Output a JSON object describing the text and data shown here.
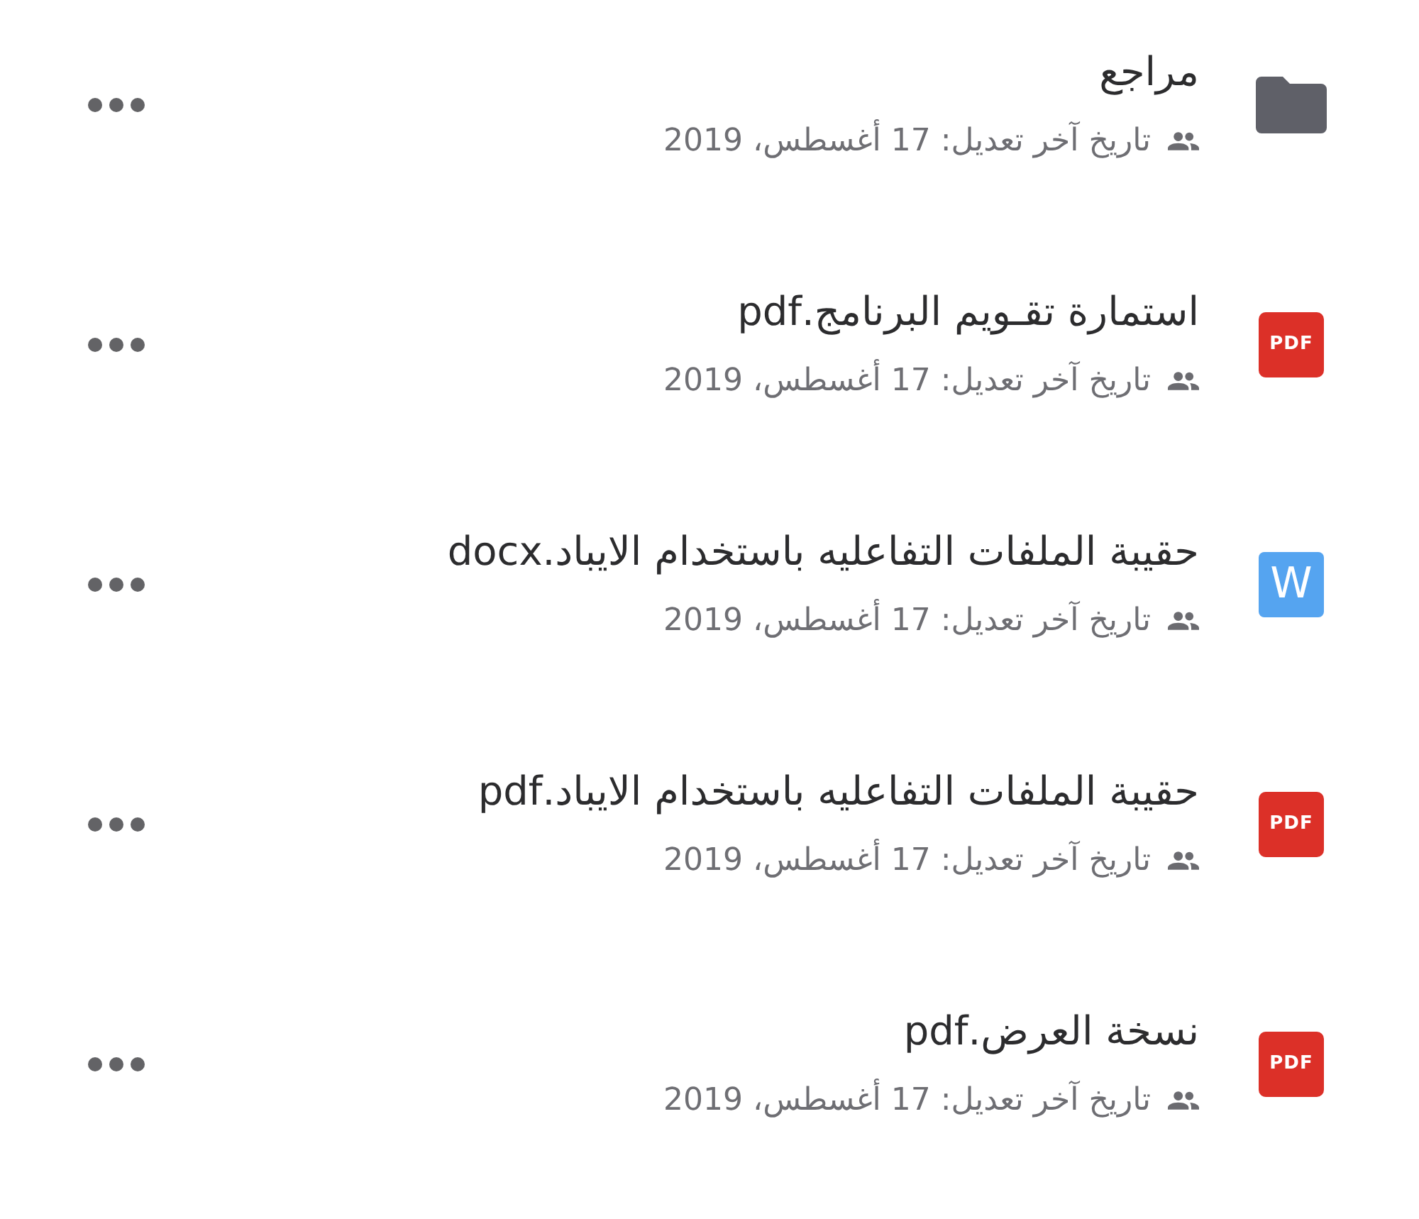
{
  "items": [
    {
      "kind": "folder",
      "name": "مراجع",
      "shared": true,
      "modified": "تاريخ آخر تعديل: 17 أغسطس، 2019"
    },
    {
      "kind": "pdf",
      "icon_label": "PDF",
      "name": "استمارة تقـويم البرنامج.pdf",
      "shared": true,
      "modified": "تاريخ آخر تعديل: 17 أغسطس، 2019"
    },
    {
      "kind": "word",
      "icon_label": "W",
      "name": "حقيبة الملفات التفاعليه باستخدام الايباد.docx",
      "shared": true,
      "modified": "تاريخ آخر تعديل: 17 أغسطس، 2019"
    },
    {
      "kind": "pdf",
      "icon_label": "PDF",
      "name": "حقيبة الملفات التفاعليه باستخدام الايباد.pdf",
      "shared": true,
      "modified": "تاريخ آخر تعديل: 17 أغسطس، 2019"
    },
    {
      "kind": "pdf",
      "icon_label": "PDF",
      "name": "نسخة العرض.pdf",
      "shared": true,
      "modified": "تاريخ آخر تعديل: 17 أغسطس، 2019"
    }
  ]
}
